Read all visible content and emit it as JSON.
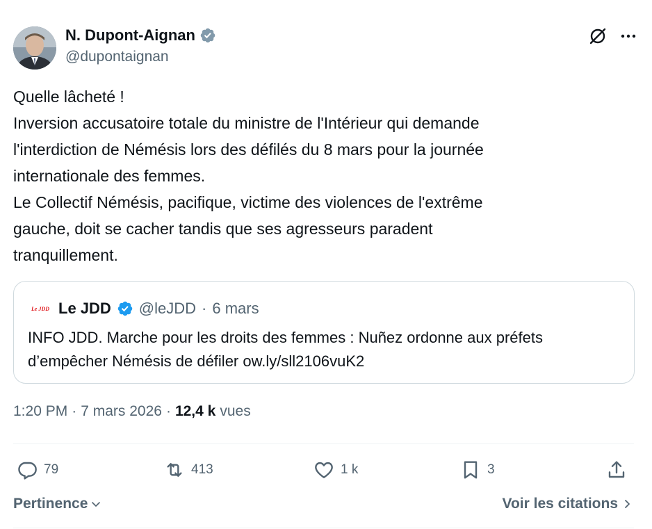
{
  "author": {
    "name": "N. Dupont-Aignan",
    "handle": "@dupontaignan",
    "verified_color": "#829aab"
  },
  "tweet": {
    "lines": [
      "Quelle lâcheté !",
      "Inversion accusatoire totale du ministre de l'Intérieur qui demande",
      "l'interdiction de Némésis lors des défilés du 8 mars pour la journée",
      "internationale des femmes.",
      "Le Collectif Némésis, pacifique, victime des violences de l'extrême",
      "gauche, doit se cacher tandis que ses agresseurs paradent",
      "tranquillement."
    ]
  },
  "quote": {
    "logo_text": "Le JDD",
    "name": "Le JDD",
    "handle": "@leJDD",
    "separator": "·",
    "date": "6 mars",
    "verified_color": "#1d9bf0",
    "lines": [
      "INFO JDD. Marche pour les droits des femmes : Nuñez ordonne aux préfets",
      "d’empêcher Némésis de défiler ow.ly/sll2106vuK2"
    ]
  },
  "meta": {
    "time": "1:20 PM",
    "separator": "·",
    "date": "7 mars 2026",
    "separator2": "·",
    "views_count": "12,4 k",
    "views_label": "vues"
  },
  "actions": {
    "replies": "79",
    "retweets": "413",
    "likes": "1 k",
    "bookmarks": "3"
  },
  "footer": {
    "sort_label": "Pertinence",
    "quotes_label": "Voir les citations"
  },
  "icons": {
    "grok": "grok-icon",
    "more": "more-icon",
    "reply": "reply-icon",
    "retweet": "retweet-icon",
    "like": "heart-icon",
    "bookmark": "bookmark-icon",
    "share": "share-icon"
  }
}
